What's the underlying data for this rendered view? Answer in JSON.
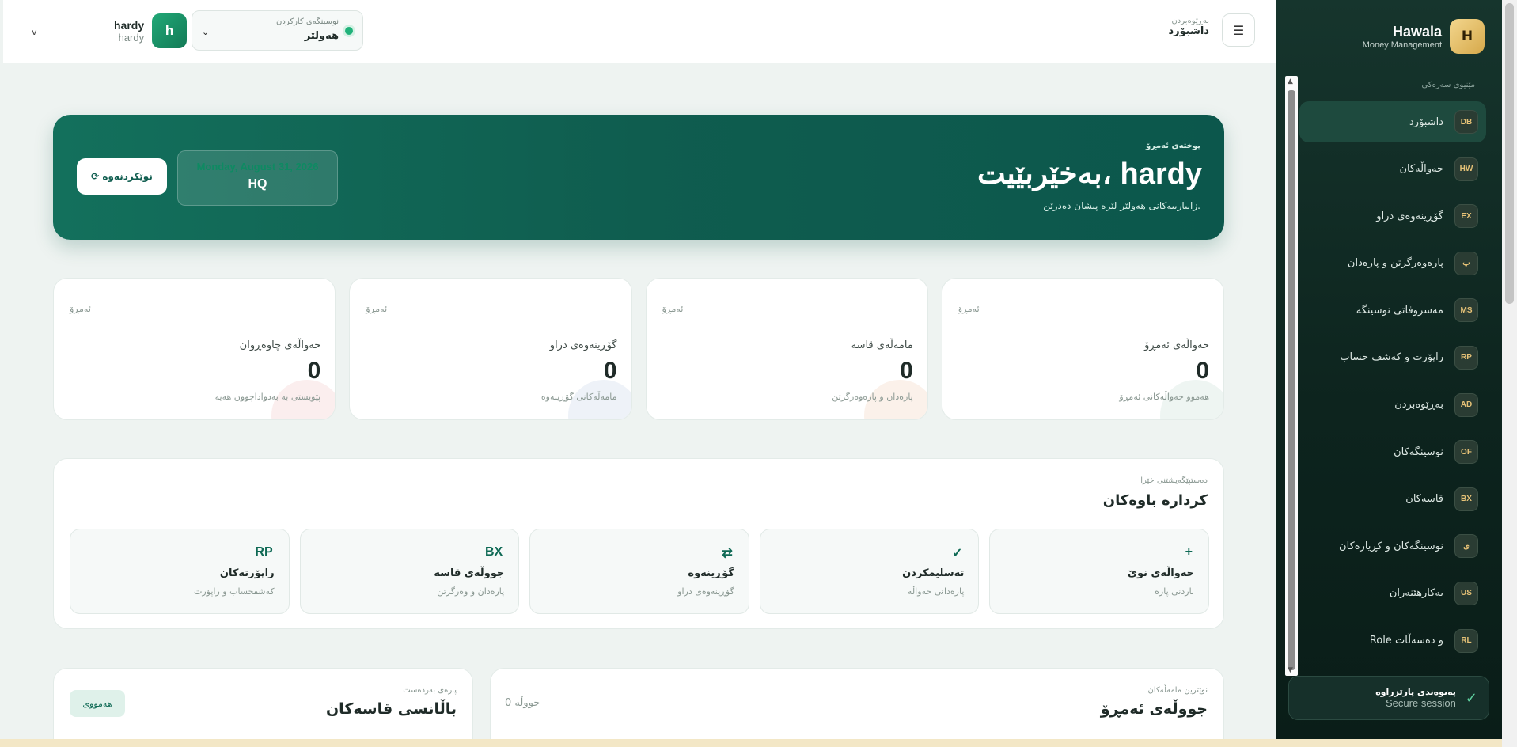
{
  "brand": {
    "name": "Hawala",
    "sub": "Money Management",
    "logo": "H"
  },
  "nav": {
    "title": "مێنیوی سەرەکی",
    "items": [
      {
        "code": "DB",
        "label": "داشبۆرد",
        "active": true
      },
      {
        "code": "HW",
        "label": "حەواڵەکان"
      },
      {
        "code": "EX",
        "label": "گۆڕینەوەی دراو"
      },
      {
        "code": "پ",
        "label": "پارەوەرگرتن و پارەدان"
      },
      {
        "code": "MS",
        "label": "مەسروفاتی نوسینگە"
      },
      {
        "code": "RP",
        "label": "راپۆرت و کەشف حساب"
      },
      {
        "code": "AD",
        "label": "بەڕێوەبردن"
      },
      {
        "code": "OF",
        "label": "نوسینگەکان"
      },
      {
        "code": "BX",
        "label": "قاسەکان"
      },
      {
        "code": "ی",
        "label": "نوسینگەکان و کڕیارەکان"
      },
      {
        "code": "US",
        "label": "بەکارهێنەران"
      },
      {
        "code": "RL",
        "label": "Role و دەسەڵات"
      }
    ]
  },
  "secure": {
    "title": "پەیوەندی پارێزراوە",
    "sub": "Secure session"
  },
  "header": {
    "crumb_small": "بەڕێوەبردن",
    "crumb_main": "داشبۆرد",
    "office_label": "نوسینگەی کارکردن",
    "office_value": "هەولێر",
    "user_name": "hardy",
    "user_sub": "hardy",
    "avatar": "h"
  },
  "hero": {
    "kicker": "پوختەی ئەمڕۆ",
    "title": "بەخێربێیت، hardy",
    "desc": "زانیارییەکانی هەولێر لێرە پیشان دەدرێن.",
    "date": "Monday, August 31, 2026",
    "branch": "HQ",
    "refresh": "⟳ نوێکردنەوە"
  },
  "stats": [
    {
      "tag": "ئەمڕۆ",
      "label": "حەواڵەی ئەمڕۆ",
      "value": "0",
      "sub": "هەموو حەواڵەکانی ئەمڕۆ",
      "blob": "#eef5f2"
    },
    {
      "tag": "ئەمڕۆ",
      "label": "مامەڵەی قاسە",
      "value": "0",
      "sub": "پارەدان و پارەوەرگرتن",
      "blob": "#fbf1ea"
    },
    {
      "tag": "ئەمڕۆ",
      "label": "گۆڕینەوەی دراو",
      "value": "0",
      "sub": "مامەڵەکانی گۆڕینەوە",
      "blob": "#eef2f8"
    },
    {
      "tag": "ئەمڕۆ",
      "label": "حەواڵەی چاوەڕوان",
      "value": "0",
      "sub": "پێویستی بە بەدواداچوون هەیە",
      "blob": "#fbeeee"
    }
  ],
  "quick": {
    "kicker": "دەستپێگەیشتنی خێرا",
    "title": "کردارە باوەکان",
    "items": [
      {
        "icon": "+",
        "title": "حەواڵەی نوێ",
        "sub": "ناردنی پارە"
      },
      {
        "icon": "✓",
        "title": "تەسلیمکردن",
        "sub": "پارەدانی حەواڵە"
      },
      {
        "icon": "⇄",
        "title": "گۆڕینەوە",
        "sub": "گۆڕینەوەی دراو"
      },
      {
        "icon": "BX",
        "title": "جووڵەی قاسە",
        "sub": "پارەدان و وەرگرتن"
      },
      {
        "icon": "RP",
        "title": "راپۆرتەکان",
        "sub": "کەشفحساب و راپۆرت"
      }
    ]
  },
  "bottom": {
    "left_kicker": "نوێترین مامەڵەکان",
    "left_title": "جووڵەی ئەمڕۆ",
    "left_count": "0 جووڵە",
    "right_kicker": "پارەی بەردەست",
    "right_title": "باڵانسی قاسەکان",
    "right_btn": "هەمووی"
  }
}
